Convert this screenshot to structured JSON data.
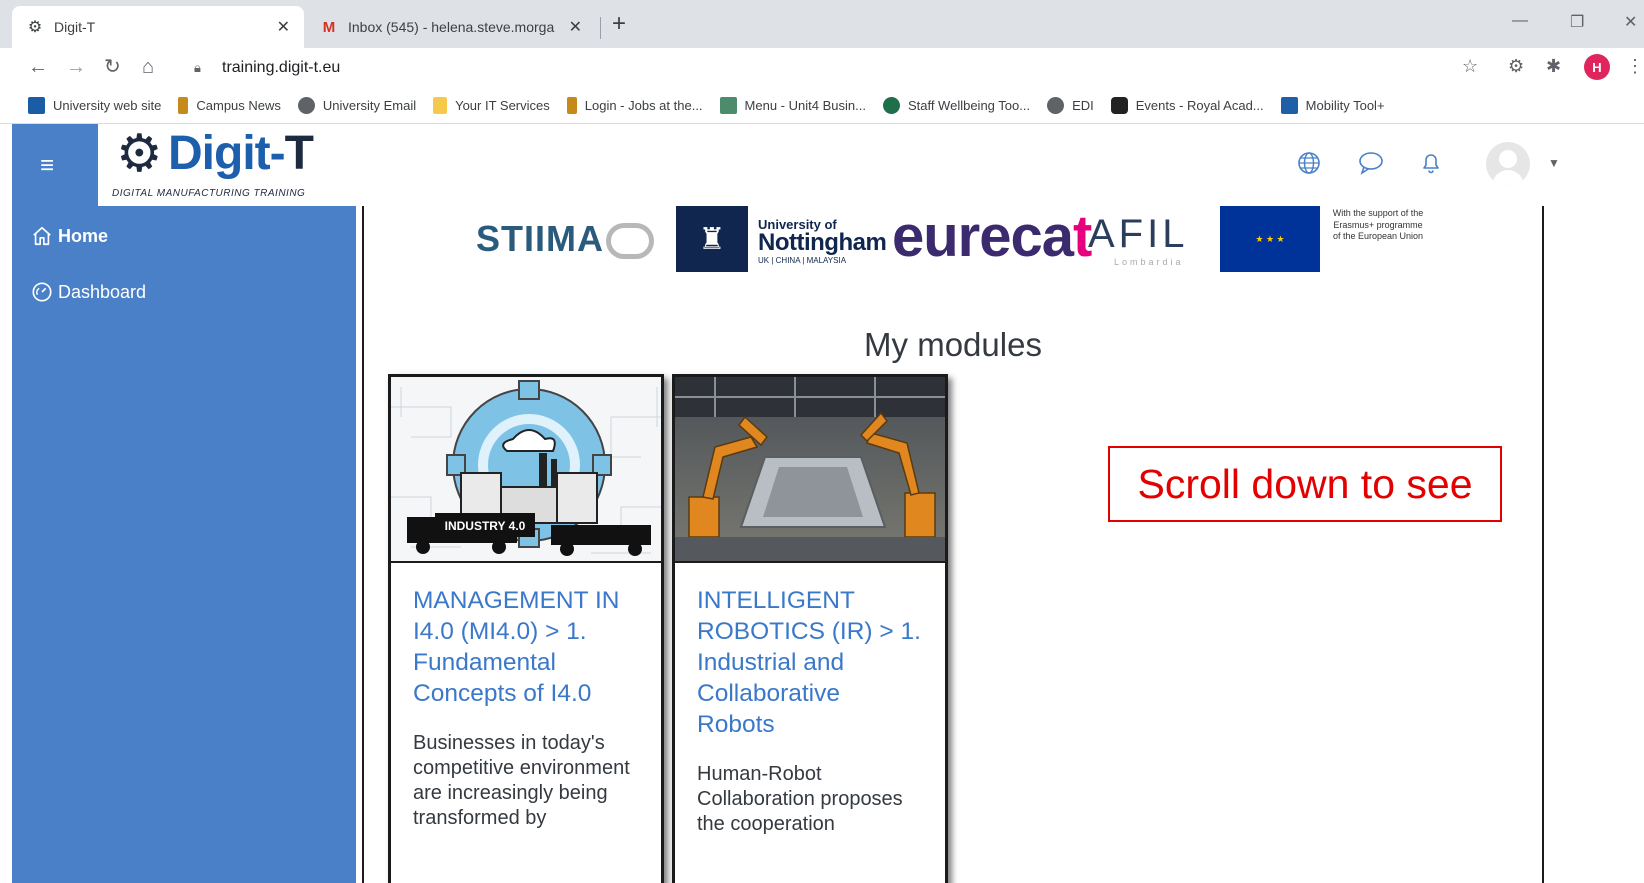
{
  "browser": {
    "tabs": [
      {
        "title": "Digit-T",
        "icon": "gear-puzzle-icon",
        "active": true
      },
      {
        "title": "Inbox (545) - helena.steve.morga",
        "icon": "gmail-icon",
        "active": false
      }
    ],
    "url": "training.digit-t.eu",
    "profile_initial": "H",
    "bookmarks": [
      {
        "label": "University web site",
        "color": "#1a5da6"
      },
      {
        "label": "Campus News",
        "color": "#c68a1a"
      },
      {
        "label": "University Email",
        "color": "#5f6368"
      },
      {
        "label": "Your IT Services",
        "color": "#f6c94a"
      },
      {
        "label": "Login - Jobs at the...",
        "color": "#c68a1a"
      },
      {
        "label": "Menu - Unit4 Busin...",
        "color": "#4c8b6b"
      },
      {
        "label": "Staff Wellbeing Too...",
        "color": "#1f6f4a"
      },
      {
        "label": "EDI",
        "color": "#5f6368"
      },
      {
        "label": "Events - Royal Acad...",
        "color": "#222222"
      },
      {
        "label": "Mobility Tool+",
        "color": "#1f5fa8"
      }
    ]
  },
  "site": {
    "brand": {
      "name_main": "Digit-",
      "name_end": "T",
      "tagline": "DIGITAL MANUFACTURING TRAINING"
    },
    "sidebar": {
      "items": [
        {
          "label": "Home",
          "icon": "home-icon"
        },
        {
          "label": "Dashboard",
          "icon": "dashboard-gauge-icon"
        }
      ]
    },
    "topnav_icons": [
      "language-globe-icon",
      "messages-bubble-icon",
      "notifications-bell-icon",
      "user-avatar-icon"
    ],
    "partners": {
      "stiima": "STIIMA",
      "nottingham_line1": "University of",
      "nottingham_line2": "Nottingham",
      "nottingham_line3": "UK | CHINA | MALAYSIA",
      "eurecat": "eureca",
      "eurecat_end": "t",
      "afil": "AFIL",
      "afil_sub": "Lombardia",
      "erasmus": "With the support of the Erasmus+ programme of the European Union"
    },
    "section_title": "My modules",
    "modules": [
      {
        "title": "MANAGEMENT IN I4.0 (MI4.0) > 1. Fundamental Concepts of I4.0",
        "description": "Businesses in today's competitive environment are increasingly being transformed by",
        "image_label": "INDUSTRY 4.0"
      },
      {
        "title": "INTELLIGENT ROBOTICS (IR) > 1. Industrial and Collaborative Robots",
        "description": "Human-Robot Collaboration proposes the cooperation",
        "image_label": ""
      }
    ],
    "annotation": "Scroll down to see"
  }
}
